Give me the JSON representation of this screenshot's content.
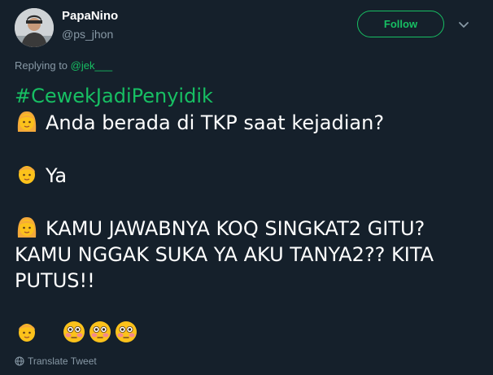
{
  "author": {
    "display_name": "PapaNino",
    "handle": "@ps_jhon",
    "avatar_icon": "profile-photo"
  },
  "follow_button": {
    "label": "Follow",
    "color": "#17bf63"
  },
  "menu_icon": "chevron-down-icon",
  "reply": {
    "prefix": "Replying to ",
    "mention": "@jek___"
  },
  "tweet": {
    "hashtag": "#CewekJadiPenyidik",
    "lines": [
      {
        "speaker": "woman-emoji",
        "text": "Anda berada di TKP saat kejadian?"
      },
      {
        "speaker": "man-emoji",
        "text": "Ya"
      },
      {
        "speaker": "woman-emoji",
        "text": "KAMU JAWABNYA KOQ SINGKAT2 GITU?"
      },
      {
        "speaker": "none",
        "text": "KAMU NGGAK SUKA YA AKU TANYA2?? KITA"
      },
      {
        "speaker": "none",
        "text": "PUTUS!!"
      },
      {
        "speaker": "man-emoji",
        "text": "",
        "emojis": [
          "flushed-face",
          "flushed-face",
          "flushed-face"
        ]
      }
    ]
  },
  "translate": {
    "label": "Translate Tweet",
    "icon": "globe-icon"
  },
  "colors": {
    "background": "#15202b",
    "accent": "#17bf63",
    "muted": "#8899a6"
  }
}
